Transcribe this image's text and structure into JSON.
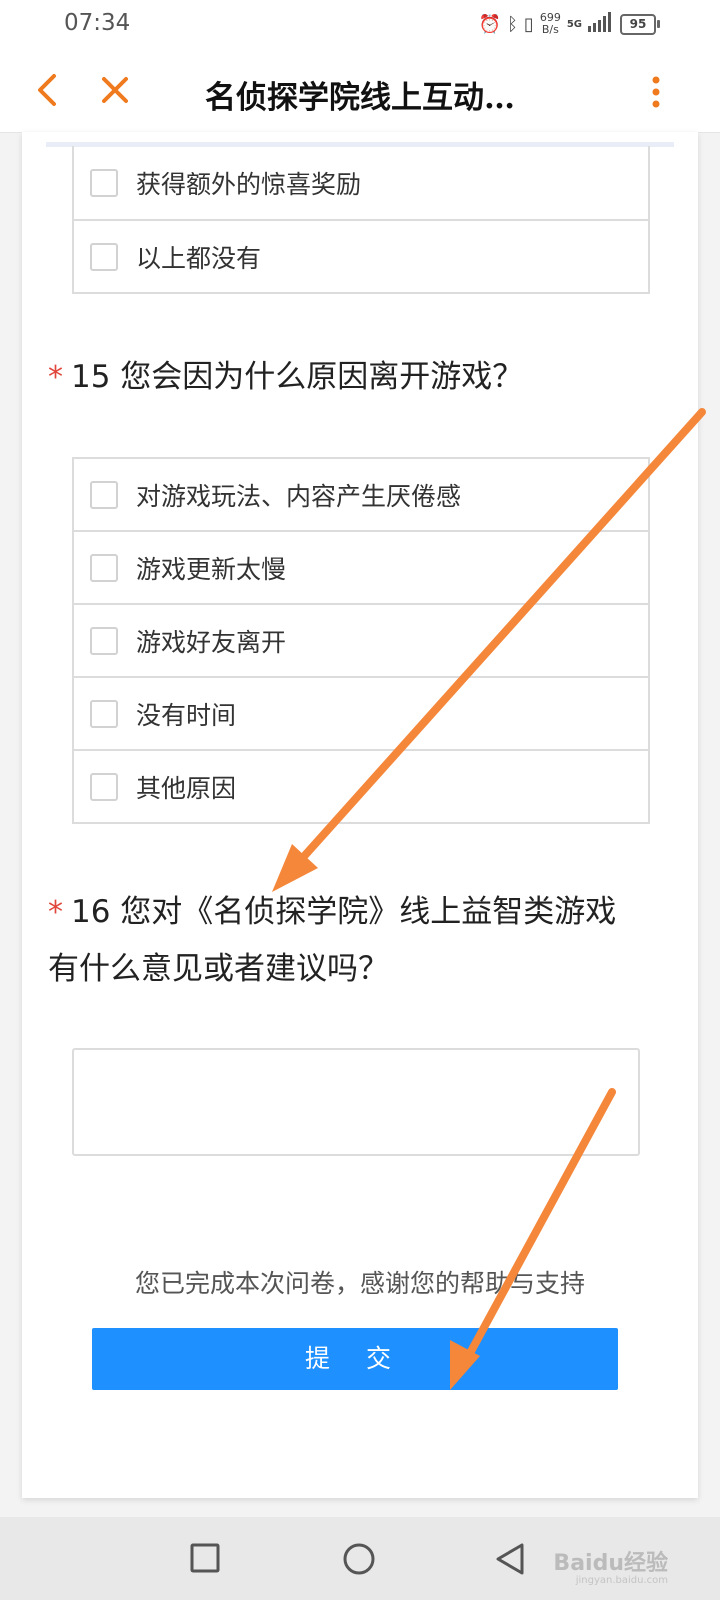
{
  "status": {
    "time": "07:34",
    "net_speed_value": "699",
    "net_speed_unit": "B/s",
    "network": "5G",
    "battery": "95"
  },
  "nav": {
    "title": "名侦探学院线上互动…"
  },
  "question14": {
    "options": [
      "获得额外的惊喜奖励",
      "以上都没有"
    ]
  },
  "question15": {
    "required_mark": "*",
    "title": "15  您会因为什么原因离开游戏？",
    "options": [
      "对游戏玩法、内容产生厌倦感",
      "游戏更新太慢",
      "游戏好友离开",
      "没有时间",
      "其他原因"
    ]
  },
  "question16": {
    "required_mark": "*",
    "title": "16  您对《名侦探学院》线上益智类游戏有什么意见或者建议吗？",
    "answer": ""
  },
  "footer": {
    "thanks": "您已完成本次问卷，感谢您的帮助与支持",
    "submit_label": "提 交"
  },
  "watermark": {
    "text": "Baidu经验",
    "sub": "jingyan.baidu.com"
  },
  "colors": {
    "accent_orange": "#f07a1e",
    "submit_blue": "#1e90ff",
    "required_red": "#e0463c",
    "annotation_arrow": "#f5873a"
  },
  "icons": [
    "alarm-icon",
    "bluetooth-icon",
    "vibrate-icon",
    "signal-icon",
    "battery-icon",
    "back-icon",
    "close-icon",
    "more-icon",
    "recent-apps-icon",
    "home-icon",
    "back-nav-icon"
  ]
}
